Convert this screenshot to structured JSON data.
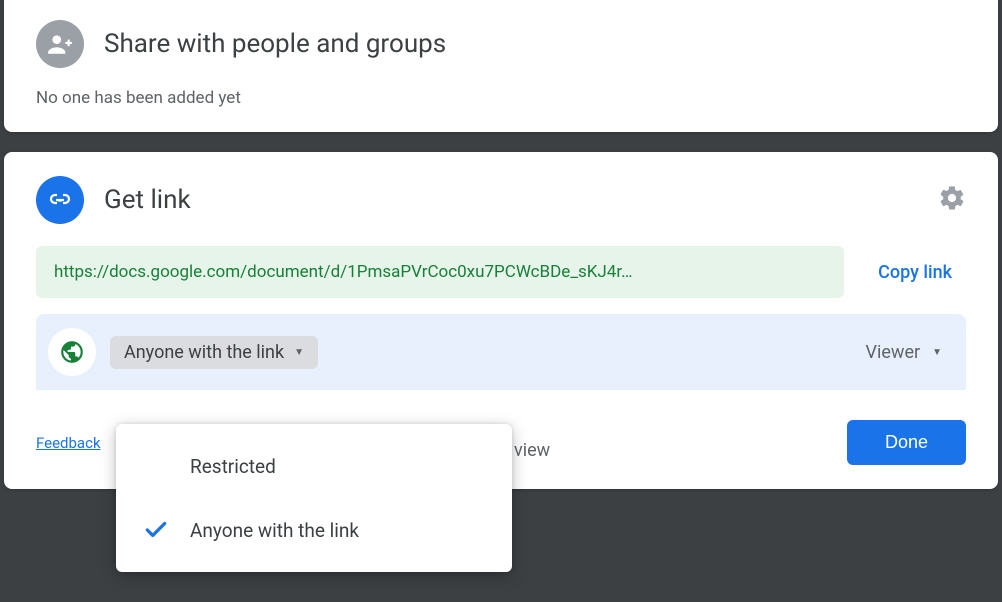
{
  "share": {
    "title": "Share with people and groups",
    "subtitle": "No one has been added yet"
  },
  "getlink": {
    "title": "Get link",
    "url": "https://docs.google.com/document/d/1PmsaPVrCoc0xu7PCWcBDe_sKJ4r…",
    "copy_label": "Copy link",
    "scope_selected": "Anyone with the link",
    "visible_desc_fragment": "view",
    "role_label": "Viewer",
    "options": {
      "restricted": "Restricted",
      "anyone": "Anyone with the link"
    }
  },
  "actions": {
    "feedback": "Feedback",
    "done": "Done"
  }
}
